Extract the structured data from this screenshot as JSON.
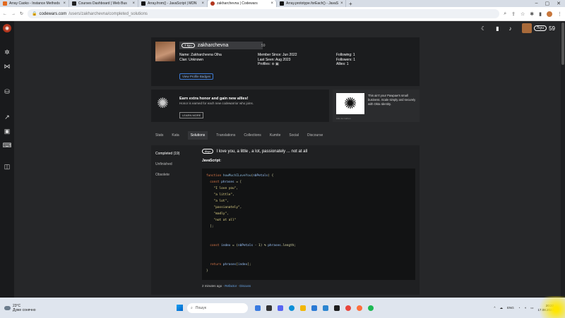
{
  "browser": {
    "tabs": [
      {
        "label": "Array Caoko - Instance Methods",
        "color": "#e36a1f"
      },
      {
        "label": "Courses Dashboard | Web Bus",
        "color": "#222222"
      },
      {
        "label": "Array.from() - JavaScript | MDN",
        "color": "#111111"
      },
      {
        "label": "zakharchevna | Codewars",
        "color": "#b1361e",
        "active": true
      },
      {
        "label": "Array.prototype.forEach() - JavaS",
        "color": "#111111"
      }
    ],
    "new_tab": "+",
    "url_host": "codewars.com",
    "url_path": "/users/zakharchevna/completed_solutions"
  },
  "header": {
    "kyu_badge": "7kyu",
    "honor": "59"
  },
  "profile": {
    "kyu": "7 kyu",
    "username": "zakharchevna",
    "honor": "59",
    "name_label": "Name:",
    "name_value": "Zakharchevna Olha",
    "clan_label": "Clan:",
    "clan_value": "Unknown",
    "member_label": "Member Since:",
    "member_value": "Jun 2022",
    "seen_label": "Last Seen:",
    "seen_value": "Aug 2023",
    "profiles_label": "Profiles:",
    "following_label": "Following:",
    "following_value": "1",
    "followers_label": "Followers:",
    "followers_value": "1",
    "allies_label": "Allies:",
    "allies_value": "1",
    "badges_button": "View Profile Badges"
  },
  "promo": {
    "title": "Earn extra honor and gain new allies!",
    "subtitle": "Honor is earned for each new codewarrior who joins.",
    "button": "LEARN MORE"
  },
  "ad": {
    "text": "This ain't your Pawpaw's small business. Scale simply and securely with Okta Identity.",
    "via": "Ads via Carbon"
  },
  "tabs": [
    "Stats",
    "Kata",
    "Solutions",
    "Translations",
    "Collections",
    "Kumite",
    "Social",
    "Discourse"
  ],
  "subnav": [
    "Completed (19)",
    "Unfinished",
    "Obsolete"
  ],
  "kata": {
    "kyu": "8kyu",
    "title": "I love you, a little , a lot, passionately ... not at all",
    "language": "JavaScript:",
    "time": "2 minutes ago",
    "refactor": "Refactor",
    "discuss": "Discuss",
    "sep": " · "
  },
  "taskbar": {
    "temp": "23°C",
    "weather": "Дуже сонячно",
    "search": "Пошук",
    "lang": "ENG",
    "time": "20:22",
    "date": "17.08.2023"
  }
}
